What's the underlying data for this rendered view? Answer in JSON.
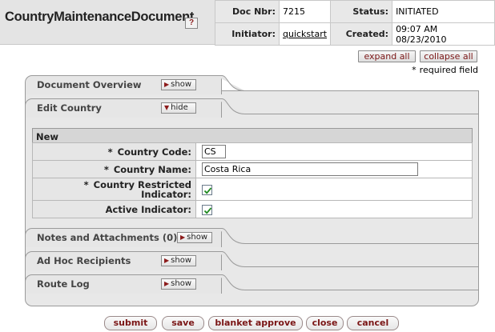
{
  "header": {
    "title": "CountryMaintenanceDocument",
    "help_icon": "?",
    "doc_nbr_label": "Doc Nbr:",
    "doc_nbr": "7215",
    "status_label": "Status:",
    "status": "INITIATED",
    "initiator_label": "Initiator:",
    "initiator": "quickstart",
    "created_label": "Created:",
    "created": "09:07 AM 08/23/2010"
  },
  "controls": {
    "expand_all": "expand all",
    "collapse_all": "collapse all",
    "required_asterisk": "*",
    "required_text": "required field"
  },
  "tabs": {
    "document_overview": {
      "label": "Document Overview",
      "toggle": "show"
    },
    "edit_country": {
      "label": "Edit Country",
      "toggle": "hide"
    },
    "notes": {
      "label": "Notes and Attachments (0)",
      "toggle": "show"
    },
    "adhoc": {
      "label": "Ad Hoc Recipients",
      "toggle": "show"
    },
    "route_log": {
      "label": "Route Log",
      "toggle": "show"
    }
  },
  "edit_country": {
    "section_header": "New",
    "fields": {
      "country_code": {
        "asterisk": "*",
        "label": "Country Code:",
        "value": "CS"
      },
      "country_name": {
        "asterisk": "*",
        "label": "Country Name:",
        "value": "Costa Rica"
      },
      "country_restricted": {
        "asterisk": "*",
        "label_line1": "Country Restricted",
        "label_line2": "Indicator:",
        "checked": true
      },
      "active": {
        "label": "Active Indicator:",
        "checked": true
      }
    }
  },
  "actions": {
    "submit": "submit",
    "save": "save",
    "blanket_approve": "blanket approve",
    "close": "close",
    "cancel": "cancel"
  },
  "colors": {
    "button_text": "#7a1515",
    "tab_background": "#e6e6e6",
    "header_background": "#e4e4e4"
  }
}
